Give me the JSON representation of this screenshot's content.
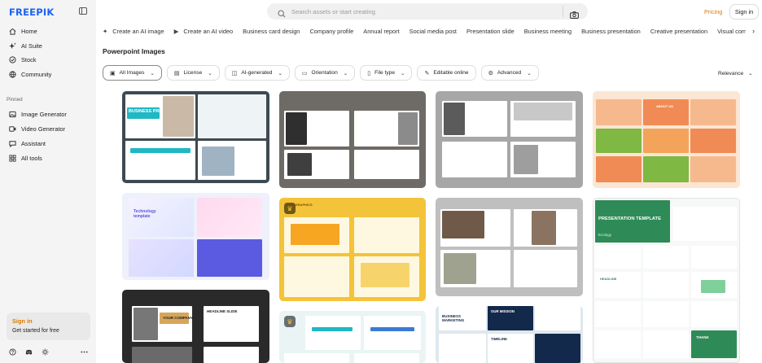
{
  "brand": {
    "logo_text": "FREEPIK",
    "accent": "#1b62f5",
    "highlight": "#e07a00"
  },
  "sidebar": {
    "items": [
      {
        "label": "Home",
        "icon": "home-icon"
      },
      {
        "label": "AI Suite",
        "icon": "sparkle-icon"
      },
      {
        "label": "Stock",
        "icon": "stock-icon"
      },
      {
        "label": "Community",
        "icon": "globe-icon"
      }
    ],
    "pinned_label": "Pinned",
    "pinned": [
      {
        "label": "Image Generator",
        "icon": "image-generator-icon"
      },
      {
        "label": "Video Generator",
        "icon": "video-generator-icon"
      },
      {
        "label": "Assistant",
        "icon": "assistant-icon"
      },
      {
        "label": "All tools",
        "icon": "grid-icon"
      }
    ],
    "signin_card": {
      "title": "Sign in",
      "subtitle": "Get started for free"
    },
    "footer_icons": [
      "help-icon",
      "discord-icon",
      "theme-icon",
      "more-icon"
    ]
  },
  "header": {
    "search_placeholder": "Search assets or start creating",
    "pricing_label": "Pricing",
    "signin_label": "Sign in"
  },
  "tags": [
    {
      "label": "Create an AI image",
      "icon": "wand-icon"
    },
    {
      "label": "Create an AI video",
      "icon": "video-icon"
    },
    {
      "label": "Business card design"
    },
    {
      "label": "Company profile"
    },
    {
      "label": "Annual report"
    },
    {
      "label": "Social media post"
    },
    {
      "label": "Presentation slide"
    },
    {
      "label": "Business meeting"
    },
    {
      "label": "Business presentation"
    },
    {
      "label": "Creative presentation"
    },
    {
      "label": "Visual commu"
    }
  ],
  "page_title": "Powerpoint Images",
  "filters": [
    {
      "label": "All Images",
      "icon": "image-icon",
      "active": true
    },
    {
      "label": "License",
      "icon": "license-icon"
    },
    {
      "label": "AI-generated",
      "icon": "ai-icon"
    },
    {
      "label": "Orientation",
      "icon": "orientation-icon"
    },
    {
      "label": "File type",
      "icon": "file-icon"
    },
    {
      "label": "Editable online",
      "icon": "edit-icon",
      "no_chevron": true
    },
    {
      "label": "Advanced",
      "icon": "settings-icon"
    }
  ],
  "sort_label": "Relevance",
  "results": [
    {
      "title": "BUSINESS PRESENTATION",
      "theme": "teal"
    },
    {
      "title": "",
      "theme": "dark-gray"
    },
    {
      "title": "",
      "theme": "gray-mono"
    },
    {
      "title": "ABOUT US",
      "theme": "orange"
    },
    {
      "title": "Technology template",
      "theme": "gradient-purple"
    },
    {
      "title": "INFOGRAPHICS",
      "theme": "yellow"
    },
    {
      "title": "",
      "theme": "architecture"
    },
    {
      "title": "PRESENTATION TEMPLATE",
      "subtitle": "Ecology",
      "theme": "green"
    },
    {
      "title": "YOUR COMPANY",
      "title2": "HEADLINE SLIDE",
      "theme": "black-gold"
    },
    {
      "title": "",
      "theme": "infographic-light"
    },
    {
      "title": "BUSINESS MARKETING",
      "title2": "OUR MISSION",
      "title3": "TIMELINE",
      "theme": "blue-navy"
    },
    {
      "title": "HEADLINE",
      "title2": "THANK",
      "theme": "mint"
    }
  ]
}
